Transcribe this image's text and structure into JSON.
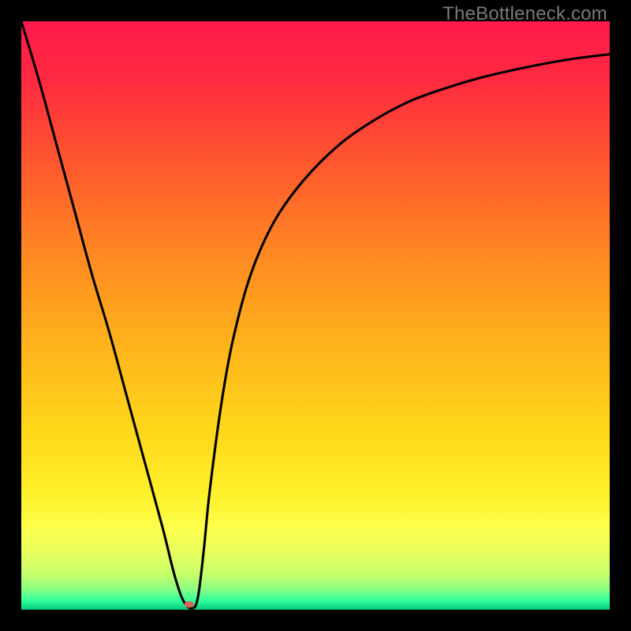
{
  "watermark": "TheBottleneck.com",
  "chart_data": {
    "type": "line",
    "title": "",
    "xlabel": "",
    "ylabel": "",
    "xlim": [
      0,
      100
    ],
    "ylim": [
      0,
      100
    ],
    "grid": false,
    "gradient_stops": [
      {
        "offset": 0.0,
        "color": "#ff1a4c"
      },
      {
        "offset": 0.1,
        "color": "#ff2a3f"
      },
      {
        "offset": 0.25,
        "color": "#ff5a2d"
      },
      {
        "offset": 0.4,
        "color": "#ff8a22"
      },
      {
        "offset": 0.55,
        "color": "#ffb31b"
      },
      {
        "offset": 0.7,
        "color": "#ffd81b"
      },
      {
        "offset": 0.8,
        "color": "#fff029"
      },
      {
        "offset": 0.86,
        "color": "#fdff4a"
      },
      {
        "offset": 0.9,
        "color": "#e9ff5c"
      },
      {
        "offset": 0.94,
        "color": "#c6ff6a"
      },
      {
        "offset": 0.965,
        "color": "#8cff84"
      },
      {
        "offset": 0.985,
        "color": "#2fff9b"
      },
      {
        "offset": 1.0,
        "color": "#05c97f"
      }
    ],
    "series": [
      {
        "name": "bottleneck-curve",
        "x": [
          0,
          3,
          6,
          9,
          12,
          15,
          18,
          21,
          24,
          26,
          27.5,
          29,
          30,
          31,
          32,
          34,
          36,
          39,
          43,
          48,
          54,
          60,
          66,
          72,
          78,
          84,
          90,
          95,
          100
        ],
        "y": [
          100,
          90,
          79,
          68,
          57,
          47,
          36,
          25,
          14,
          6,
          1.6,
          0.2,
          2,
          10,
          20,
          35,
          46,
          57,
          66,
          73,
          79,
          83.2,
          86.4,
          88.6,
          90.4,
          91.8,
          93.0,
          93.8,
          94.4
        ]
      }
    ],
    "marker": {
      "x": 28.5,
      "y": 0.9,
      "color": "#d5645a",
      "rx": 6,
      "ry": 4.2
    }
  }
}
